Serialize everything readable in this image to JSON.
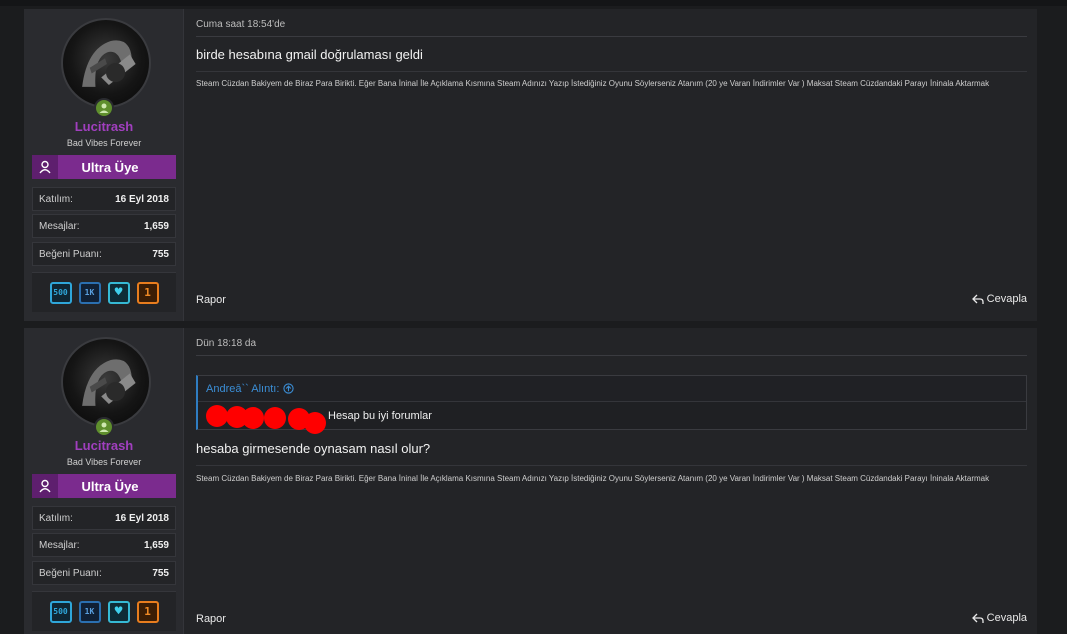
{
  "posts": [
    {
      "user": {
        "name": "Lucitrash",
        "title": "Bad Vibes Forever",
        "banner": "Ultra Üye",
        "stats": [
          {
            "label": "Katılım:",
            "value": "16 Eyl 2018"
          },
          {
            "label": "Mesajlar:",
            "value": "1,659"
          },
          {
            "label": "Beğeni Puanı:",
            "value": "755"
          }
        ],
        "trophies": [
          "500",
          "1K",
          "heart-icon",
          "1"
        ]
      },
      "time": "Cuma saat 18:54'de",
      "message": "birde hesabına gmail doğrulaması geldi",
      "signature": "Steam Cüzdan Bakiyem de Biraz Para Birikti. Eğer Bana İninal İle Açıklama Kısmına Steam Adınızı Yazıp İstediğiniz Oyunu Söylerseniz Atanım (20 ye Varan İndirimler Var ) Maksat Steam Cüzdandaki Parayı İninala Aktarmak",
      "report": "Rapor",
      "reply": "Cevapla"
    },
    {
      "user": {
        "name": "Lucitrash",
        "title": "Bad Vibes Forever",
        "banner": "Ultra Üye",
        "stats": [
          {
            "label": "Katılım:",
            "value": "16 Eyl 2018"
          },
          {
            "label": "Mesajlar:",
            "value": "1,659"
          },
          {
            "label": "Beğeni Puanı:",
            "value": "755"
          }
        ],
        "trophies": [
          "500",
          "1K",
          "heart-icon",
          "1"
        ]
      },
      "time": "Dün 18:18 da",
      "quote": {
        "author": "Andreā`` Alıntı:",
        "text": "Hesap bu iyi forumlar"
      },
      "message": "hesaba girmesende oynasam nasıl olur?",
      "signature": "Steam Cüzdan Bakiyem de Biraz Para Birikti. Eğer Bana İninal İle Açıklama Kısmına Steam Adınızı Yazıp İstediğiniz Oyunu Söylerseniz Atanım (20 ye Varan İndirimler Var ) Maksat Steam Cüzdandaki Parayı İninala Aktarmak",
      "report": "Rapor",
      "reply": "Cevapla"
    }
  ],
  "colors": {
    "username": "#a13fbf",
    "banner": "#7b2b8e",
    "link": "#3b8ed6",
    "online": "#5f8f2d"
  }
}
